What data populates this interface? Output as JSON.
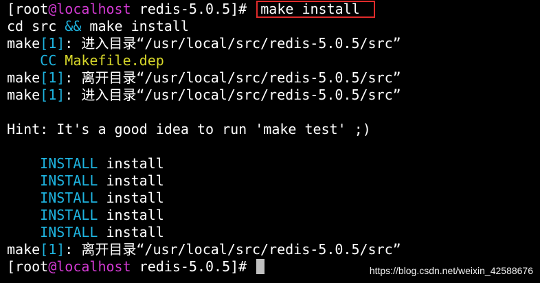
{
  "colors": {
    "background": "#000000",
    "text": "#ffffff",
    "magenta": "#d33ad3",
    "cyan": "#1eb4e0",
    "yellow": "#d6d62a",
    "highlight_box": "#e02b2b"
  },
  "prompt": {
    "open": "[root",
    "at": "@",
    "host": "localhost",
    "dir": " redis-5.0.5]# "
  },
  "lines": {
    "command": "make install",
    "cd": "cd src ",
    "and": "&&",
    "cd_rest": " make install",
    "make": "make",
    "bracket_num": "[1]",
    "enter_dir": ": 进入目录“/usr/local/src/redis-5.0.5/src”",
    "leave_dir": ": 离开目录“/usr/local/src/redis-5.0.5/src”",
    "cc": "CC",
    "makefile": " Makefile.dep",
    "hint": "Hint: It's a good idea to run 'make test' ;)",
    "install_kw": "INSTALL",
    "install_arg": " install"
  },
  "watermark": "https://blog.csdn.net/weixin_42588676"
}
